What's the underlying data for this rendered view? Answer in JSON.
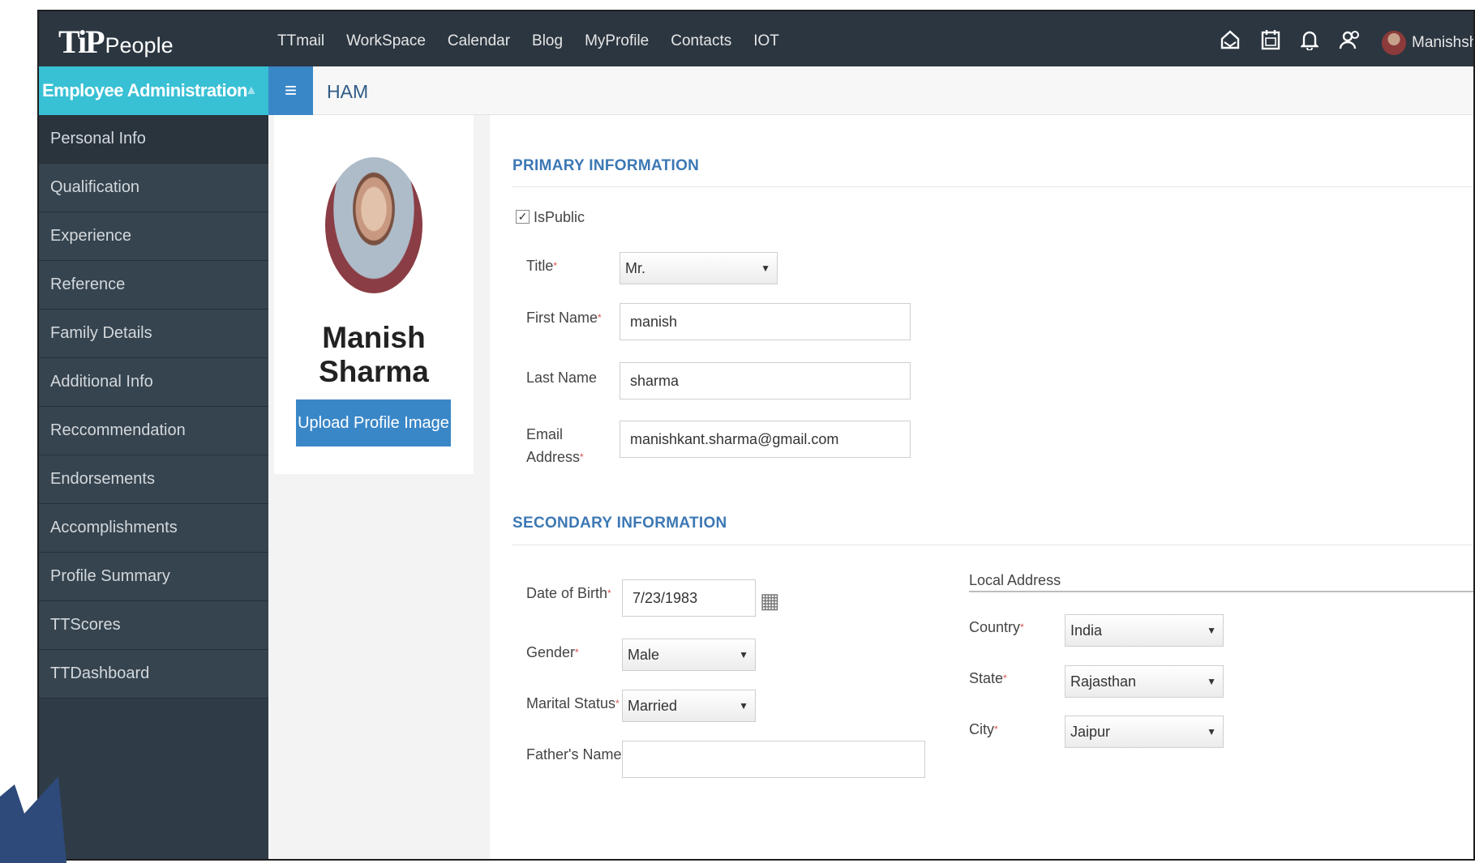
{
  "app": {
    "logo_main": "TiP",
    "logo_sub": "People"
  },
  "topnav": [
    "TTmail",
    "WorkSpace",
    "Calendar",
    "Blog",
    "MyProfile",
    "Contacts",
    "IOT"
  ],
  "topicons": [
    "home-icon",
    "calendar-icon",
    "bell-icon",
    "users-icon"
  ],
  "user": {
    "name": "Manishsharma"
  },
  "sidebar": {
    "title": "Employee Administration",
    "items": [
      {
        "label": "Personal Info",
        "active": true
      },
      {
        "label": "Qualification"
      },
      {
        "label": "Experience"
      },
      {
        "label": "Reference"
      },
      {
        "label": "Family Details"
      },
      {
        "label": "Additional Info"
      },
      {
        "label": "Reccommendation"
      },
      {
        "label": "Endorsements"
      },
      {
        "label": "Accomplishments"
      },
      {
        "label": "Profile Summary"
      },
      {
        "label": "TTScores"
      },
      {
        "label": "TTDashboard"
      }
    ]
  },
  "header": {
    "module": "HAM"
  },
  "profile": {
    "name": "Manish Sharma",
    "upload_label": "Upload Profile Image"
  },
  "primary": {
    "title": "PRIMARY INFORMATION",
    "ispublic_label": "IsPublic",
    "ispublic_checked": true,
    "title_label": "Title",
    "title_value": "Mr.",
    "first_name_label": "First Name",
    "first_name_value": "manish",
    "last_name_label": "Last Name",
    "last_name_value": "sharma",
    "email_label_1": "Email",
    "email_label_2": "Address",
    "email_value": "manishkant.sharma@gmail.com"
  },
  "secondary": {
    "title": "SECONDARY INFORMATION",
    "dob_label": "Date of Birth",
    "dob_value": "7/23/1983",
    "gender_label": "Gender",
    "gender_value": "Male",
    "marital_label": "Marital Status",
    "marital_value": "Married",
    "father_label": "Father's Name"
  },
  "address": {
    "title": "Local Address",
    "country_label": "Country",
    "country_value": "India",
    "state_label": "State",
    "state_value": "Rajasthan",
    "city_label": "City",
    "city_value": "Jaipur"
  },
  "colors": {
    "topbar": "#2b3640",
    "sidebar": "#2f3c47",
    "sidebar_header": "#38c0d4",
    "accent_blue": "#3a87c8",
    "section_title": "#3c78b4",
    "arrow": "#2d4a7a"
  }
}
